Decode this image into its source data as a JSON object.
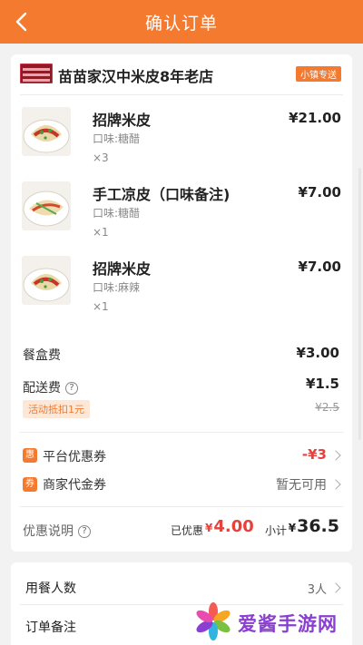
{
  "header": {
    "title": "确认订单",
    "back_icon": "chevron-left-icon"
  },
  "shop": {
    "name": "苗苗家汉中米皮8年老店",
    "badge": "小镇专送"
  },
  "items": [
    {
      "name": "招牌米皮",
      "spec": "口味:糖醋",
      "qty": "×3",
      "price": "¥21.00"
    },
    {
      "name": "手工凉皮（口味备注)",
      "spec": "口味:糖醋",
      "qty": "×1",
      "price": "¥7.00"
    },
    {
      "name": "招牌米皮",
      "spec": "口味:麻辣",
      "qty": "×1",
      "price": "¥7.00"
    }
  ],
  "fees": {
    "box_label": "餐盒费",
    "box_value": "¥3.00",
    "delivery_label": "配送费",
    "delivery_value": "¥1.5",
    "delivery_promo": "活动抵扣1元",
    "delivery_original": "¥2.5"
  },
  "coupons": {
    "platform_icon": "惠",
    "platform_label": "平台优惠券",
    "platform_value": "-¥3",
    "merchant_icon": "券",
    "merchant_label": "商家代金券",
    "merchant_value": "暂无可用"
  },
  "summary": {
    "explain_label": "优惠说明",
    "saved_label": "已优惠",
    "saved_currency": "¥",
    "saved_value": "4.00",
    "subtotal_label": "小计",
    "subtotal_currency": "¥",
    "subtotal_value": "36.5"
  },
  "extra": {
    "diners_label": "用餐人数",
    "diners_value": "3人",
    "note_label": "订单备注"
  },
  "watermark": {
    "text": "爱酱手游网"
  },
  "colors": {
    "accent": "#f47a30",
    "price_red": "#e8403a",
    "background": "#f2f2f2"
  }
}
